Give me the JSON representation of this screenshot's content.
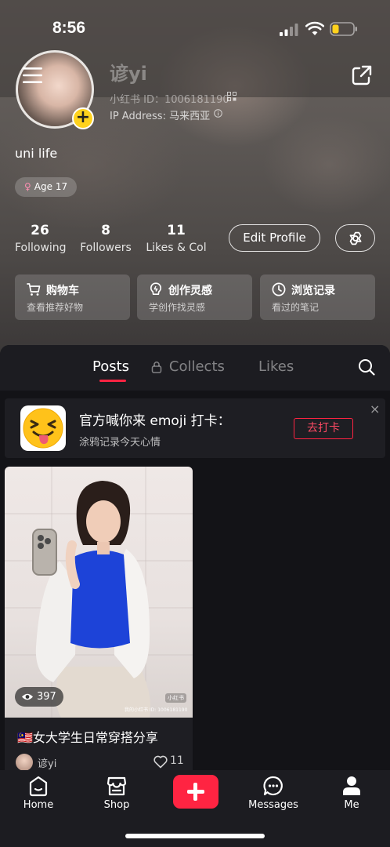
{
  "status_bar": {
    "time": "8:56"
  },
  "profile": {
    "username": "谚yi",
    "user_id": "小红书 ID：1006181190",
    "ip_address": "IP Address: 马来西亚",
    "bio": "uni life",
    "gender_age": "Age 17",
    "gender_symbol": "♀"
  },
  "stats": [
    {
      "value": "26",
      "label": "Following"
    },
    {
      "value": "8",
      "label": "Followers"
    },
    {
      "value": "11",
      "label": "Likes & Col"
    }
  ],
  "actions": {
    "edit_profile": "Edit Profile"
  },
  "shortcuts": [
    {
      "title": "购物车",
      "subtitle": "查看推荐好物",
      "icon": "cart-icon"
    },
    {
      "title": "创作灵感",
      "subtitle": "学创作找灵感",
      "icon": "bulb-icon"
    },
    {
      "title": "浏览记录",
      "subtitle": "看过的笔记",
      "icon": "clock-icon"
    }
  ],
  "tabs": {
    "posts": "Posts",
    "collects": "Collects",
    "likes": "Likes"
  },
  "banner": {
    "title": "官方喊你来 emoji 打卡：",
    "subtitle": "涂鸦记录今天心情",
    "button": "去打卡",
    "close": "×"
  },
  "post": {
    "views": "397",
    "watermark": "小红书",
    "watermark_id": "我的小红书 ID: 1006181190",
    "title": "🇲🇾女大学生日常穿搭分享",
    "author": "谚yi",
    "likes": "11"
  },
  "nav": {
    "home": "Home",
    "shop": "Shop",
    "messages": "Messages",
    "me": "Me"
  },
  "colors": {
    "accent": "#ff2442",
    "badge_yellow": "#ffd21d",
    "panel": "#131317"
  }
}
